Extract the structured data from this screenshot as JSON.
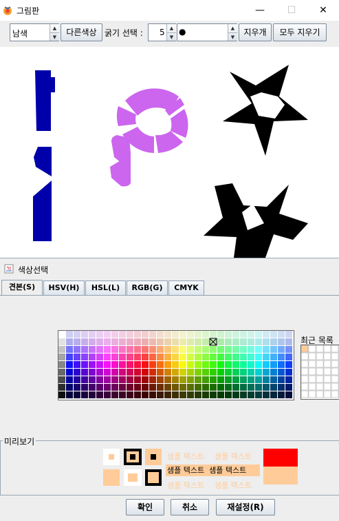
{
  "window": {
    "title": "그림판",
    "minimize_glyph": "—",
    "maximize_glyph": "☐",
    "close_glyph": "✕"
  },
  "toolbar": {
    "color_select": "남색",
    "other_color_button": "다른색상",
    "thickness_label": "굵기 선택 :",
    "thickness_value": "5",
    "brush_preview": "●",
    "erase_button": "지우개",
    "clear_all_button": "모두 지우기"
  },
  "canvas": {
    "shapes": [
      {
        "name": "navy-line-stroke",
        "color": "#0000aa"
      },
      {
        "name": "purple-p-stroke",
        "color": "#cc66ee"
      },
      {
        "name": "black-star-outline",
        "color": "#000000"
      },
      {
        "name": "black-filled-star",
        "color": "#000000"
      }
    ]
  },
  "chooser": {
    "title": "색상선택",
    "tabs": [
      "견본(S)",
      "HSV(H)",
      "HSL(L)",
      "RGB(G)",
      "CMYK"
    ],
    "active_tab": "견본(S)",
    "recent_label": "최근 목록",
    "recent_first_color": "#ffcc99",
    "preview_label": "미리보기",
    "sample_text": "샘플 텍스트",
    "preview_color": "#ff0000",
    "selected_color": "#ffcc99",
    "buttons": {
      "ok": "확인",
      "cancel": "취소",
      "reset": "재설정(R)"
    }
  }
}
